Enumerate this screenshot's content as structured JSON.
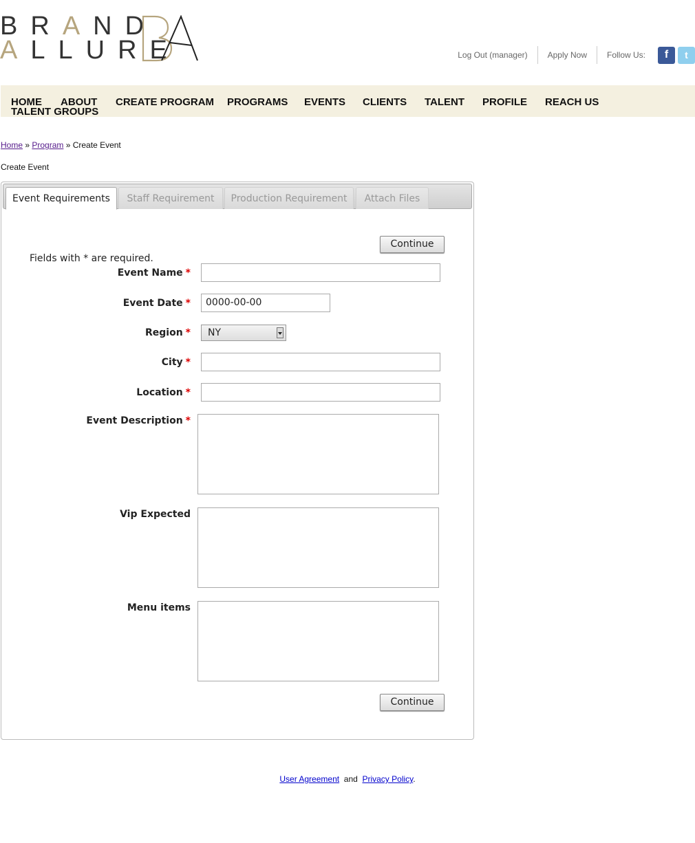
{
  "logo": {
    "line1": [
      "B",
      "R",
      "A",
      "N",
      "D"
    ],
    "line2": [
      "A",
      "L",
      "L",
      "U",
      "R",
      "E"
    ],
    "mark": "BA"
  },
  "toplinks": {
    "logout": "Log Out (manager)",
    "apply": "Apply Now",
    "follow": "Follow Us:",
    "facebook_glyph": "f",
    "twitter_glyph": "t"
  },
  "nav": [
    "HOME",
    "ABOUT",
    "CREATE PROGRAM",
    "PROGRAMS",
    "EVENTS",
    "CLIENTS",
    "TALENT",
    "PROFILE",
    "REACH US",
    "TALENT GROUPS"
  ],
  "breadcrumb": {
    "home": "Home",
    "sep1": " » ",
    "program": "Program",
    "sep2": " » ",
    "current": "Create Event"
  },
  "page_heading": "Create Event",
  "tabs": [
    "Event Requirements",
    "Staff Requirement",
    "Production Requirement",
    "Attach Files"
  ],
  "form": {
    "continue_label": "Continue",
    "note": "Fields with * are required.",
    "required_mark": "*",
    "event_name": {
      "label": "Event Name",
      "value": ""
    },
    "event_date": {
      "label": "Event Date",
      "value": "0000-00-00"
    },
    "region": {
      "label": "Region",
      "value": "NY"
    },
    "city": {
      "label": "City",
      "value": ""
    },
    "location": {
      "label": "Location",
      "value": ""
    },
    "event_description": {
      "label": "Event Description",
      "value": ""
    },
    "vip_expected": {
      "label": "Vip Expected",
      "value": ""
    },
    "menu_items": {
      "label": "Menu items",
      "value": ""
    }
  },
  "footer": {
    "user_agreement": "User Agreement",
    "and": "and",
    "privacy": "Privacy Policy",
    "period": "."
  },
  "colors": {
    "nav_bg": "#f4f0e0",
    "logo_gold": "#b6a57e",
    "required": "#dd0000"
  }
}
